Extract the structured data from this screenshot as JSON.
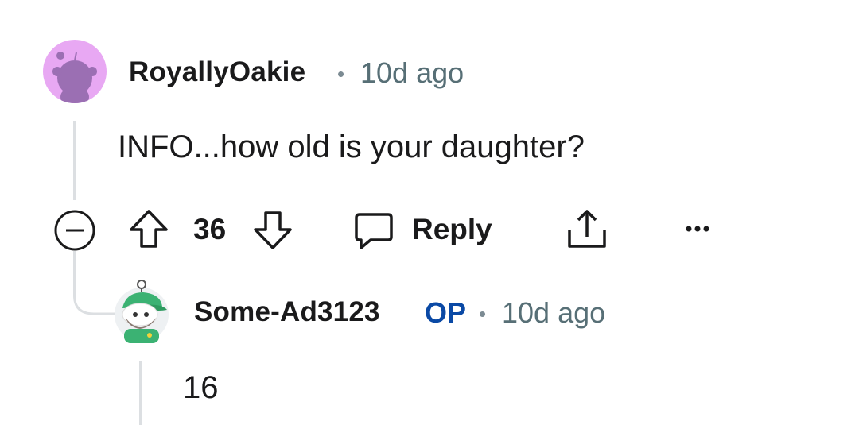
{
  "comment": {
    "author": "RoyallyOakie",
    "time": "10d ago",
    "body": "INFO...how old is your daughter?",
    "score": "36",
    "reply_label": "Reply",
    "avatar_color": "#e8a8f3",
    "avatar_icon": "snoo-avatar"
  },
  "reply": {
    "author": "Some-Ad3123",
    "badge": "OP",
    "time": "10d ago",
    "body": "16",
    "avatar_icon": "snoo-avatar-green-cap"
  },
  "colors": {
    "op_badge": "#0a49a5",
    "meta_text": "#576f76",
    "thread_line": "#dcdfe2"
  }
}
